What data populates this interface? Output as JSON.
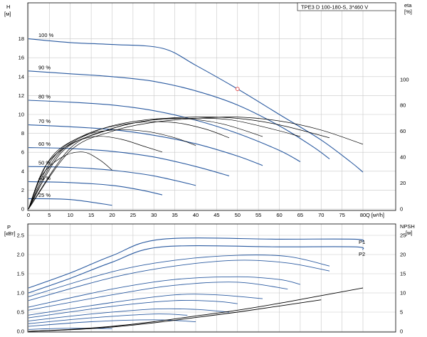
{
  "chart_data": [
    {
      "type": "line",
      "title": "TPE3 D 100-180-S, 3*460 V",
      "xlabel": "Q [м³/h]",
      "ylabel": "H [м]",
      "ylabel_symbol": "H",
      "ylabel_unit": "[м]",
      "y2label_symbol": "eta",
      "y2label_unit": "[%]",
      "x_ticks": [
        "0",
        "5",
        "10",
        "15",
        "20",
        "25",
        "30",
        "35",
        "40",
        "45",
        "50",
        "55",
        "60",
        "65",
        "70",
        "75",
        "80"
      ],
      "y_ticks": [
        "0",
        "2",
        "4",
        "6",
        "8",
        "10",
        "12",
        "14",
        "16",
        "18"
      ],
      "y2_ticks": [
        "0",
        "20",
        "40",
        "60",
        "80",
        "100"
      ],
      "xlim": [
        0,
        85
      ],
      "ylim": [
        0,
        20
      ],
      "y2lim": [
        0,
        146
      ],
      "grid": true,
      "head_series": [
        {
          "name": "100 %",
          "points": [
            [
              0,
              18.0
            ],
            [
              10,
              17.6
            ],
            [
              20,
              17.4
            ],
            [
              32,
              17.0
            ],
            [
              40,
              15.2
            ],
            [
              50,
              12.7
            ],
            [
              60,
              10.0
            ],
            [
              70,
              7.3
            ],
            [
              77,
              5.0
            ],
            [
              80,
              3.9
            ]
          ]
        },
        {
          "name": "90 %",
          "points": [
            [
              0,
              14.6
            ],
            [
              10,
              14.3
            ],
            [
              20,
              14.0
            ],
            [
              30,
              13.5
            ],
            [
              40,
              12.5
            ],
            [
              50,
              11.0
            ],
            [
              60,
              8.8
            ],
            [
              68,
              6.6
            ],
            [
              72,
              5.3
            ]
          ]
        },
        {
          "name": "80 %",
          "points": [
            [
              0,
              11.5
            ],
            [
              10,
              11.3
            ],
            [
              20,
              11.0
            ],
            [
              30,
              10.4
            ],
            [
              40,
              9.4
            ],
            [
              50,
              8.0
            ],
            [
              60,
              6.2
            ],
            [
              65,
              5.0
            ]
          ]
        },
        {
          "name": "70 %",
          "points": [
            [
              0,
              8.9
            ],
            [
              10,
              8.7
            ],
            [
              20,
              8.4
            ],
            [
              30,
              7.8
            ],
            [
              40,
              6.9
            ],
            [
              50,
              5.6
            ],
            [
              56,
              4.6
            ]
          ]
        },
        {
          "name": "60 %",
          "points": [
            [
              0,
              6.5
            ],
            [
              10,
              6.4
            ],
            [
              20,
              6.1
            ],
            [
              30,
              5.5
            ],
            [
              40,
              4.5
            ],
            [
              48,
              3.5
            ]
          ]
        },
        {
          "name": "50 %",
          "points": [
            [
              0,
              4.5
            ],
            [
              10,
              4.4
            ],
            [
              20,
              4.1
            ],
            [
              30,
              3.5
            ],
            [
              40,
              2.5
            ]
          ]
        },
        {
          "name": "40 %",
          "points": [
            [
              0,
              2.9
            ],
            [
              10,
              2.8
            ],
            [
              20,
              2.5
            ],
            [
              27,
              2.0
            ],
            [
              32,
              1.5
            ]
          ]
        },
        {
          "name": "25 %",
          "points": [
            [
              0,
              1.1
            ],
            [
              10,
              1.0
            ],
            [
              20,
              0.4
            ]
          ]
        }
      ],
      "duty_point": {
        "x": 50,
        "y": 12.7
      },
      "efficiency_series": [
        {
          "points": [
            [
              0,
              0
            ],
            [
              10,
              45
            ],
            [
              20,
              60
            ],
            [
              30,
              67
            ],
            [
              40,
              70
            ],
            [
              50,
              71
            ],
            [
              60,
              68
            ],
            [
              70,
              61
            ],
            [
              80,
              50
            ]
          ]
        },
        {
          "points": [
            [
              0,
              0
            ],
            [
              10,
              47
            ],
            [
              20,
              62
            ],
            [
              30,
              69
            ],
            [
              40,
              71
            ],
            [
              50,
              70
            ],
            [
              60,
              65
            ],
            [
              72,
              55
            ]
          ]
        },
        {
          "points": [
            [
              0,
              0
            ],
            [
              8,
              44
            ],
            [
              18,
              60
            ],
            [
              28,
              68
            ],
            [
              38,
              70
            ],
            [
              48,
              69
            ],
            [
              58,
              62
            ],
            [
              65,
              56
            ]
          ]
        },
        {
          "points": [
            [
              0,
              0
            ],
            [
              7,
              42
            ],
            [
              16,
              60
            ],
            [
              26,
              68
            ],
            [
              36,
              70
            ],
            [
              46,
              66
            ],
            [
              56,
              56
            ]
          ]
        },
        {
          "points": [
            [
              0,
              0
            ],
            [
              6,
              40
            ],
            [
              14,
              58
            ],
            [
              24,
              66
            ],
            [
              34,
              67
            ],
            [
              42,
              62
            ],
            [
              48,
              55
            ]
          ]
        },
        {
          "points": [
            [
              0,
              0
            ],
            [
              5,
              38
            ],
            [
              12,
              55
            ],
            [
              20,
              61
            ],
            [
              28,
              60
            ],
            [
              35,
              55
            ],
            [
              40,
              49
            ]
          ]
        },
        {
          "points": [
            [
              0,
              0
            ],
            [
              4,
              33
            ],
            [
              10,
              50
            ],
            [
              16,
              56
            ],
            [
              22,
              54
            ],
            [
              28,
              48
            ],
            [
              32,
              44
            ]
          ]
        },
        {
          "points": [
            [
              0,
              0
            ],
            [
              3,
              25
            ],
            [
              8,
              40
            ],
            [
              13,
              44
            ],
            [
              17,
              38
            ],
            [
              20,
              30
            ]
          ]
        }
      ]
    },
    {
      "type": "line",
      "xlabel": "",
      "ylabel": "P [кВт]",
      "ylabel_symbol": "P",
      "ylabel_unit": "[кВт]",
      "y2label_symbol": "NPSH",
      "y2label_unit": "[м]",
      "y_ticks": [
        "0.0",
        "0.5",
        "1.0",
        "1.5",
        "2.0",
        "2.5"
      ],
      "y2_ticks": [
        "0",
        "5",
        "10",
        "15",
        "20",
        "25"
      ],
      "ylim": [
        0,
        2.8
      ],
      "y2lim": [
        0,
        28
      ],
      "grid": true,
      "power_series": [
        {
          "name": "P1",
          "points": [
            [
              0,
              1.13
            ],
            [
              10,
              1.52
            ],
            [
              20,
              1.97
            ],
            [
              32,
              2.4
            ],
            [
              60,
              2.4
            ],
            [
              78,
              2.4
            ],
            [
              80,
              2.33
            ]
          ]
        },
        {
          "name": "P2",
          "points": [
            [
              0,
              1.0
            ],
            [
              10,
              1.38
            ],
            [
              20,
              1.8
            ],
            [
              32,
              2.2
            ],
            [
              60,
              2.2
            ],
            [
              78,
              2.2
            ],
            [
              80,
              2.13
            ]
          ]
        },
        {
          "points": [
            [
              0,
              0.9
            ],
            [
              20,
              1.55
            ],
            [
              35,
              1.85
            ],
            [
              50,
              1.98
            ],
            [
              62,
              1.95
            ],
            [
              72,
              1.7
            ]
          ]
        },
        {
          "points": [
            [
              0,
              0.8
            ],
            [
              20,
              1.4
            ],
            [
              35,
              1.7
            ],
            [
              50,
              1.85
            ],
            [
              62,
              1.78
            ],
            [
              72,
              1.57
            ]
          ]
        },
        {
          "points": [
            [
              0,
              0.63
            ],
            [
              20,
              1.1
            ],
            [
              35,
              1.35
            ],
            [
              50,
              1.42
            ],
            [
              60,
              1.35
            ],
            [
              65,
              1.22
            ]
          ]
        },
        {
          "points": [
            [
              0,
              0.55
            ],
            [
              20,
              0.95
            ],
            [
              35,
              1.2
            ],
            [
              50,
              1.28
            ],
            [
              62,
              1.1
            ]
          ]
        },
        {
          "points": [
            [
              0,
              0.42
            ],
            [
              20,
              0.75
            ],
            [
              35,
              0.95
            ],
            [
              45,
              0.95
            ],
            [
              56,
              0.85
            ]
          ]
        },
        {
          "points": [
            [
              0,
              0.35
            ],
            [
              20,
              0.65
            ],
            [
              35,
              0.8
            ],
            [
              45,
              0.78
            ],
            [
              50,
              0.72
            ]
          ]
        },
        {
          "points": [
            [
              0,
              0.27
            ],
            [
              15,
              0.45
            ],
            [
              30,
              0.58
            ],
            [
              40,
              0.57
            ],
            [
              48,
              0.5
            ]
          ]
        },
        {
          "points": [
            [
              0,
              0.2
            ],
            [
              15,
              0.35
            ],
            [
              30,
              0.45
            ],
            [
              38,
              0.42
            ]
          ]
        },
        {
          "points": [
            [
              0,
              0.13
            ],
            [
              15,
              0.25
            ],
            [
              30,
              0.3
            ],
            [
              40,
              0.25
            ]
          ]
        },
        {
          "points": [
            [
              0,
              0.05
            ],
            [
              10,
              0.08
            ],
            [
              20,
              0.07
            ]
          ]
        }
      ],
      "npsh_series": [
        {
          "points": [
            [
              0,
              0.0
            ],
            [
              10,
              0.5
            ],
            [
              20,
              1.3
            ],
            [
              30,
              2.5
            ],
            [
              40,
              4.0
            ],
            [
              50,
              5.5
            ],
            [
              60,
              7.3
            ],
            [
              70,
              9.3
            ],
            [
              80,
              11.3
            ]
          ]
        },
        {
          "points": [
            [
              0,
              0.0
            ],
            [
              10,
              0.4
            ],
            [
              20,
              1.1
            ],
            [
              30,
              2.2
            ],
            [
              40,
              3.6
            ],
            [
              50,
              5.0
            ],
            [
              60,
              6.6
            ],
            [
              70,
              8.2
            ]
          ]
        }
      ]
    }
  ],
  "colors": {
    "curve": "#2a5aa0",
    "eff": "#000000",
    "duty": "#e04040",
    "grid": "#c8c8c8"
  }
}
